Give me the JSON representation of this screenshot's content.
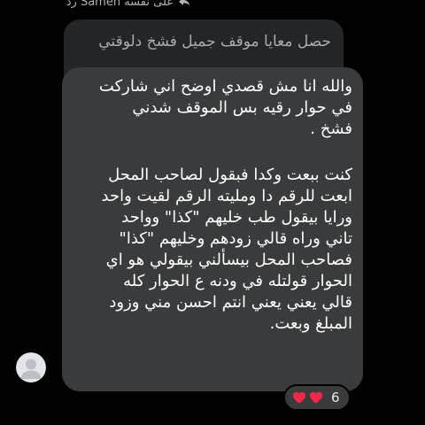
{
  "reply_header": {
    "text": "على نفسه Sameh رد",
    "icon": "reply-arrow-icon"
  },
  "quoted_message": {
    "text": "حصل معايا موقف جميل فشخ دلوقتي"
  },
  "message": {
    "paragraph1": [
      "والله انا مش قصدي اوضح اني شاركت",
      "في حوار رقيه بس الموقف شدني",
      "فشخ ."
    ],
    "paragraph2": [
      "كنت ببعت وكدا فبقول لصاحب المحل",
      "ابعت للرقم دا ومليته الرقم لقيت واحد",
      "ورايا بيقول طب خليهم \"كذا\" وواحد",
      "تاني وراه قالي زودهم وخليهم \"كذا\"",
      "فصاحب المحل بيسألني بيقولي هو اي",
      "الحوار قولتله في ودنه ع الحوار كله",
      "قالي يعني يعني انتم احسن مني وزود",
      "المبلغ وبعت."
    ]
  },
  "avatar": {
    "icon": "default-avatar-icon"
  },
  "reactions": {
    "icons": [
      "heart-icon",
      "heart-icon"
    ],
    "count": "6",
    "color": "#f02849"
  },
  "colors": {
    "background": "#000000",
    "bubble": "#3a3b3c",
    "quoted_bubble": "#242526",
    "text": "#ffffff",
    "muted_text": "#b0b3b8"
  }
}
